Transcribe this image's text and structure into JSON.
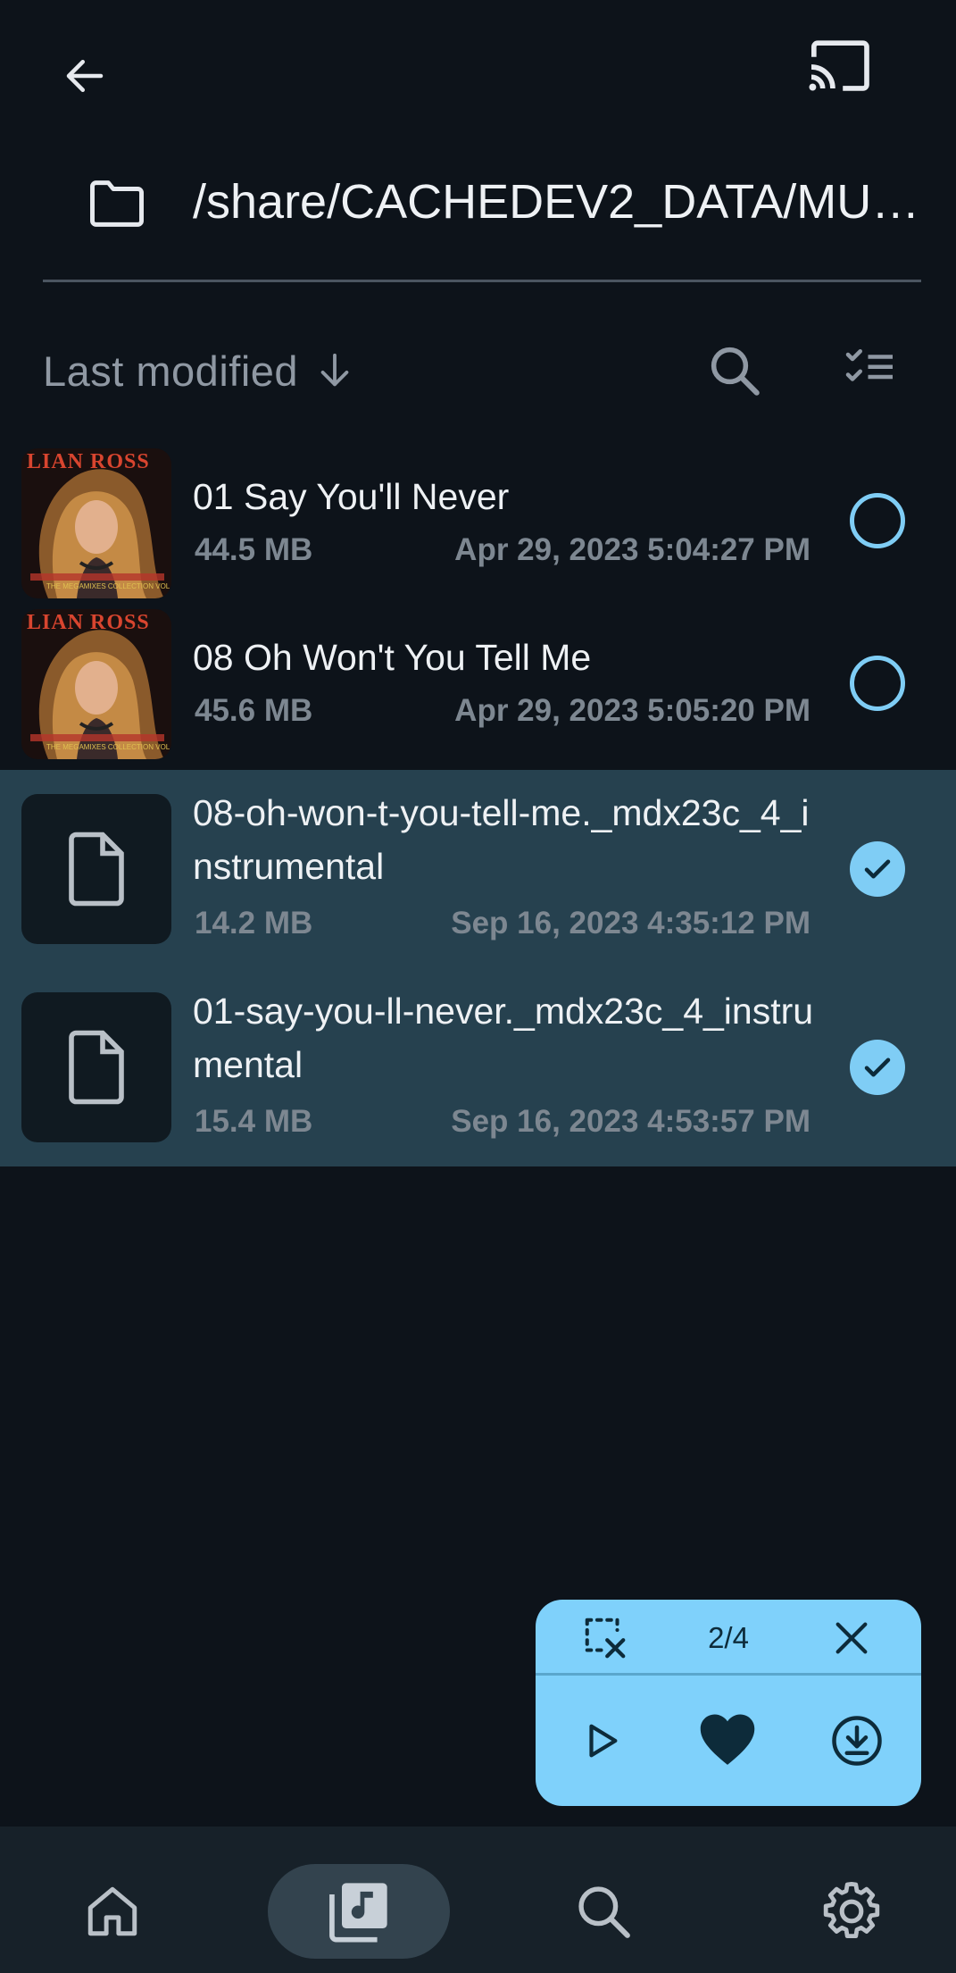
{
  "header": {
    "back_icon": "arrow-left-icon",
    "cast_icon": "cast-icon"
  },
  "path": {
    "icon": "folder-icon",
    "text": "/share/CACHEDEV2_DATA/MUS..."
  },
  "sort": {
    "label": "Last modified",
    "direction_icon": "arrow-down-icon",
    "search_icon": "search-icon",
    "multi_select_icon": "checklist-icon"
  },
  "files": [
    {
      "title": "01 Say You'll Never",
      "size": "44.5 MB",
      "date": "Apr 29, 2023 5:04:27 PM",
      "selected": false,
      "thumb": "album-art"
    },
    {
      "title": "08 Oh Won't You Tell Me",
      "size": "45.6 MB",
      "date": "Apr 29, 2023 5:05:20 PM",
      "selected": false,
      "thumb": "album-art"
    },
    {
      "title": "08-oh-won-t-you-tell-me._mdx23c_4_instrumental",
      "size": "14.2 MB",
      "date": "Sep 16, 2023 4:35:12 PM",
      "selected": true,
      "thumb": "file-icon"
    },
    {
      "title": "01-say-you-ll-never._mdx23c_4_instrumental",
      "size": "15.4 MB",
      "date": "Sep 16, 2023 4:53:57 PM",
      "selected": true,
      "thumb": "file-icon"
    }
  ],
  "album_art": {
    "artist_text": "LIAN ROSS",
    "subtitle_text": "THE MEGAMIXES COLLECTION VOL.1"
  },
  "selection_panel": {
    "count": "2/4",
    "deselect_icon": "deselect-icon",
    "close_icon": "close-icon",
    "play_icon": "play-icon",
    "favorite_icon": "heart-icon",
    "download_icon": "download-icon"
  },
  "bottom_nav": {
    "items": [
      {
        "icon": "home-icon",
        "active": false
      },
      {
        "icon": "library-music-icon",
        "active": true
      },
      {
        "icon": "search-icon",
        "active": false
      },
      {
        "icon": "settings-gear-icon",
        "active": false
      }
    ]
  },
  "colors": {
    "background": "#0d131a",
    "selected_row": "#26414f",
    "accent": "#7fcdf5",
    "secondary_text": "#7d8791"
  }
}
